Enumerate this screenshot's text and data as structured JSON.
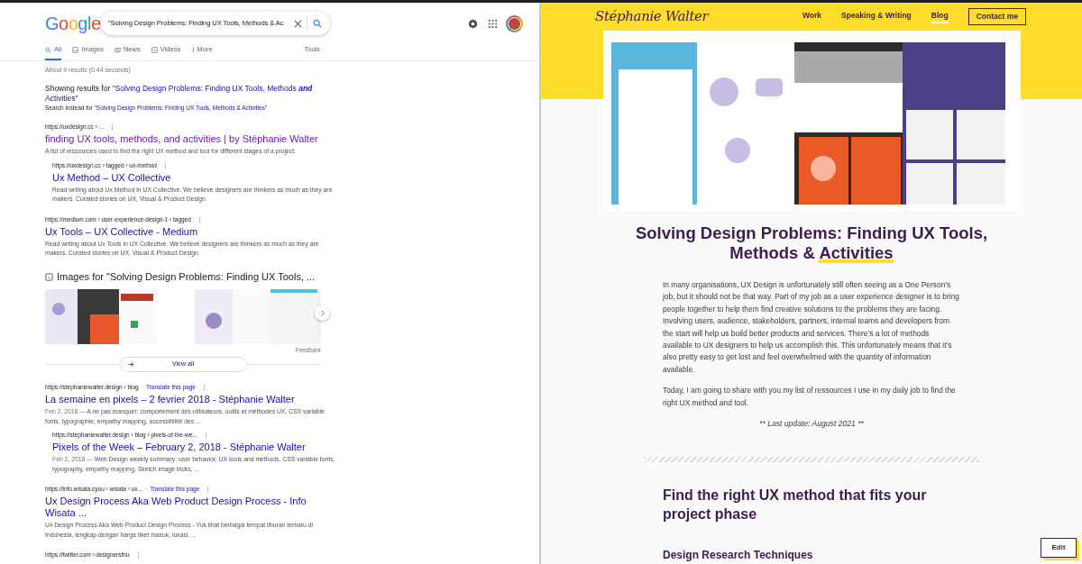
{
  "search_page": {
    "logo": "Google",
    "query": "\"Solving Design Problems: Finding UX Tools, Methods & Ac",
    "tabs": [
      {
        "label": "All",
        "selected": true,
        "kind": "all"
      },
      {
        "label": "Images",
        "selected": false,
        "kind": "images"
      },
      {
        "label": "News",
        "selected": false,
        "kind": "news"
      },
      {
        "label": "Videos",
        "selected": false,
        "kind": "videos"
      },
      {
        "label": "More",
        "selected": false,
        "kind": "more"
      }
    ],
    "tools": "Tools",
    "stats": "About 9 results (0.44 seconds)",
    "spelling": {
      "showing_prefix": "Showing results for",
      "corrected": "\"Solving Design Problems: Finding UX Tools, Methods **and** Activities\"",
      "instead_prefix": "Search instead for",
      "original": "\"Solving Design Problems: Finding UX Tools, Methods & Activities\""
    },
    "blocks": [
      {
        "kind": "result",
        "indented": false,
        "url": "https://uxdesign.cc › ...",
        "title": "finding UX tools, methods, and activities | by Stéphanie Walter",
        "visited": true,
        "snippet": "A list of ressources used to find the right UX method and tool for different stages of a project."
      },
      {
        "kind": "result",
        "indented": true,
        "url": "https://uxdesign.cc › tagged › ux-method",
        "title": "Ux Method – UX Collective",
        "visited": false,
        "snippet": "Read writing about Ux Method in UX Collective. We believe designers are thinkers as much as they are makers. Curated stories on UX, Visual & Product Design."
      },
      {
        "kind": "result",
        "indented": false,
        "url": "https://medium.com › user-experience-design-1 › tagged",
        "title": "Ux Tools – UX Collective - Medium",
        "visited": false,
        "snippet": "Read writing about Ux Tools in UX Collective. We believe designers are thinkers as much as they are makers. Curated stories on UX, Visual & Product Design."
      },
      {
        "kind": "images",
        "heading": "Images for \"Solving Design Problems: Finding UX Tools, ...",
        "feedback": "Feedback",
        "view_all": "View all"
      },
      {
        "kind": "result",
        "indented": false,
        "url": "https://stephaniewalter.design › blog",
        "separator": "·",
        "translate": "Translate this page",
        "title": "La semaine en pixels – 2 fevrier 2018 - Stéphanie Walter",
        "visited": false,
        "date": "Feb 2, 2018 —",
        "snippet": "A ne pas manquer: comportement des utilisateurs. outils et méthodes UX, CSS variable fonts, typographie, empathy mapping, accessibilité des ..."
      },
      {
        "kind": "result",
        "indented": true,
        "url": "https://stephaniewalter.design › blog › pixels-of-the-we...",
        "title": "Pixels of the Week – February 2, 2018 - Stéphanie Walter",
        "visited": false,
        "date": "Feb 2, 2018 —",
        "snippet": "Web Design weekly summary: user behavior, UX tools and methods, CSS variable fonts, typography, empathy mapping, Sketch image tricks, ..."
      },
      {
        "kind": "result",
        "indented": false,
        "url": "https://info.wisata.cyou › wisata › ux...",
        "separator": "·",
        "translate": "Translate this page",
        "title": "Ux Design Process Aka Web Product Design Process - Info Wisata ...",
        "visited": false,
        "snippet": "Ux Design Process Aka Web Product Design Process - Yuk lihat berbagai tempat liburan terbaru di Indonesia, lengkap dengan harga tiket masuk, lokasi, ..."
      },
      {
        "kind": "result",
        "indented": false,
        "url": "https://twitter.com › designersthu"
      }
    ]
  },
  "blog_page": {
    "logo": "Stéphanie Walter",
    "nav": [
      {
        "label": "Work",
        "selected": false
      },
      {
        "label": "Speaking & Writing",
        "selected": false
      },
      {
        "label": "Blog",
        "selected": true
      }
    ],
    "contact": "Contact me",
    "hero": {
      "kind": "picture"
    },
    "title": {
      "text": "Solving Design Problems: Finding UX Tools, Methods &",
      "highlighted": "Activities"
    },
    "paragraphs": [
      "In many organisations, UX Design is unfortunately still often seeing as a One Person’s job, but it should not be that way. Part of my job as a user experience designer is to bring people together to help them find creative solutions to the problems they are facing. Involving users, audience, stakeholders, partners, internal teams and developers from the start will help us build better products and services. There’s a lot of methods available to UX designers to help us accomplish this. This unfortunately means that it’s also pretty easy to get lost and feel overwhelmed with the quantity of information available.",
      "Today, I am going to share with you my list of ressources I use in my daily job to find the right UX method and tool."
    ],
    "last_update": "** Last update: August 2021 **",
    "section_heading": "Find the right UX method that fits your project phase",
    "subheading": "Design Research Techniques",
    "edit": "Edit"
  }
}
